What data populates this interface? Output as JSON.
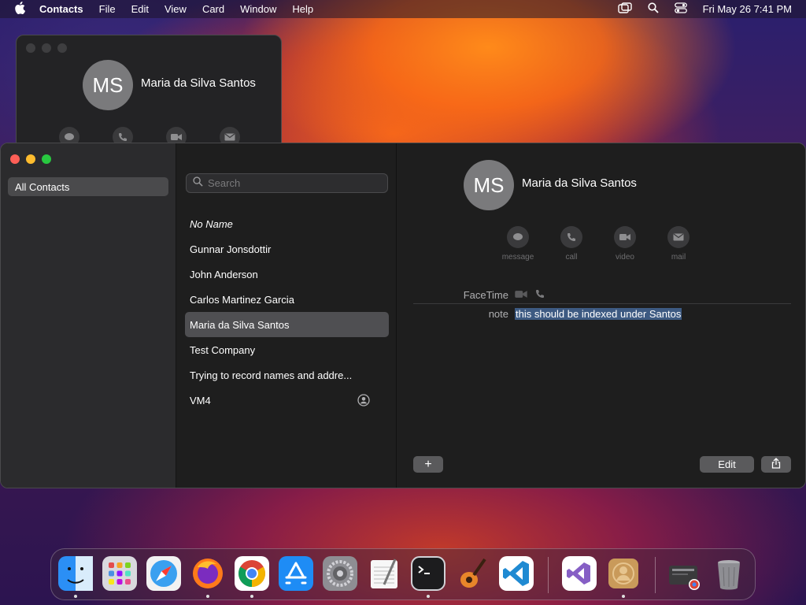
{
  "menubar": {
    "app_name": "Contacts",
    "menus": [
      "File",
      "Edit",
      "View",
      "Card",
      "Window",
      "Help"
    ],
    "clock": "Fri May 26  7:41 PM"
  },
  "card_window": {
    "initials": "MS",
    "name": "Maria da Silva Santos"
  },
  "sidebar": {
    "group": "All Contacts"
  },
  "search": {
    "placeholder": "Search"
  },
  "contacts": [
    {
      "name": "No Name",
      "italic": true
    },
    {
      "name": "Gunnar Jonsdottir"
    },
    {
      "name": "John Anderson"
    },
    {
      "name": "Carlos Martinez Garcia"
    },
    {
      "name": "Maria da Silva Santos",
      "selected": true
    },
    {
      "name": "Test Company"
    },
    {
      "name": "Trying to record names and addre..."
    },
    {
      "name": "VM4",
      "me_card": true
    }
  ],
  "detail": {
    "initials": "MS",
    "name": "Maria da Silva Santos",
    "actions": [
      {
        "label": "message",
        "icon": "message-icon"
      },
      {
        "label": "call",
        "icon": "phone-icon"
      },
      {
        "label": "video",
        "icon": "video-icon"
      },
      {
        "label": "mail",
        "icon": "mail-icon"
      }
    ],
    "facetime_label": "FaceTime",
    "note_label": "note",
    "note_value": "this should be indexed under Santos",
    "add_label": "+",
    "edit_label": "Edit"
  },
  "dock": [
    {
      "name": "finder",
      "color": "#2b8ff5",
      "running": true
    },
    {
      "name": "launchpad",
      "color": "#d9d9de",
      "running": false
    },
    {
      "name": "safari",
      "color": "#3aa0f0",
      "running": false
    },
    {
      "name": "firefox",
      "color": "#ff7a1a",
      "running": true
    },
    {
      "name": "chrome",
      "color": "#ffffff",
      "running": true
    },
    {
      "name": "app-store",
      "color": "#1e8cf5",
      "running": false
    },
    {
      "name": "system-settings",
      "color": "#8e8e93",
      "running": false
    },
    {
      "name": "textedit",
      "color": "#f2f2f2",
      "running": false
    },
    {
      "name": "terminal",
      "color": "#1c1c1e",
      "running": true
    },
    {
      "name": "garageband",
      "color": "#e8862a",
      "running": false
    },
    {
      "name": "vscode",
      "color": "#ffffff",
      "running": false
    },
    {
      "name": "visual-studio",
      "color": "#ffffff",
      "running": false
    },
    {
      "name": "contacts",
      "color": "#c99a5a",
      "running": true
    },
    {
      "name": "downloads-stack",
      "color": "#3a3a3c",
      "running": false
    },
    {
      "name": "trash",
      "color": "#9a9a9e",
      "running": false
    }
  ]
}
